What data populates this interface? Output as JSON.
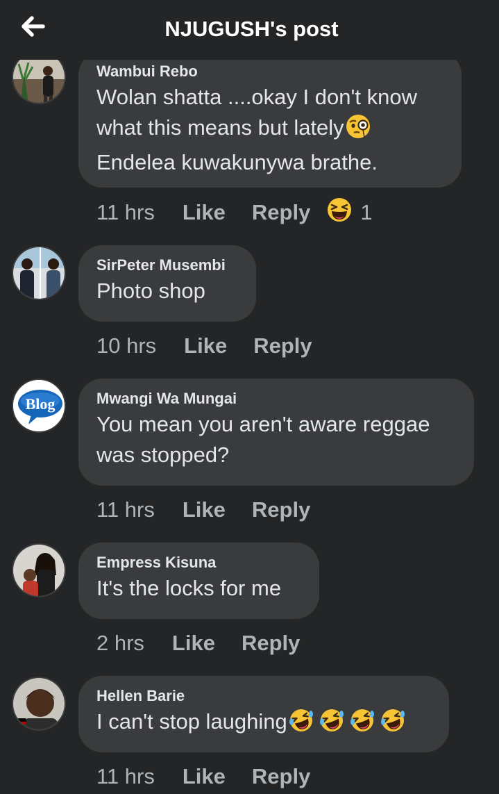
{
  "header": {
    "title": "NJUGUSH's post",
    "back_icon": "arrow-left-icon"
  },
  "colors": {
    "background": "#242526",
    "bubble": "#3a3b3c",
    "text": "#e4e6eb",
    "meta": "#b0b3b8"
  },
  "actions": {
    "like": "Like",
    "reply": "Reply"
  },
  "comments": [
    {
      "author": "Wambui Rebo",
      "lines": [
        "Wolan shatta ....okay I don't know",
        "what this means but lately",
        "Endelea kuwakunywa brathe."
      ],
      "inline_emoji": "face-with-monocle-emoji",
      "time": "11 hrs",
      "reaction": {
        "icon": "laughing-squint-emoji",
        "count": "1"
      }
    },
    {
      "author": "SirPeter Musembi",
      "lines": [
        "Photo shop"
      ],
      "time": "10 hrs"
    },
    {
      "author": "Mwangi Wa Mungai",
      "avatar_text": "Blog",
      "lines": [
        "You mean you aren't aware reggae",
        "was stopped?"
      ],
      "time": "11 hrs"
    },
    {
      "author": "Empress Kisuna",
      "lines": [
        "It's the locks for me"
      ],
      "time": "2 hrs"
    },
    {
      "author": "Hellen Barie",
      "lines": [
        "I can't stop laughing"
      ],
      "trailing_emojis": [
        "rolling-on-floor-laughing-emoji",
        "rolling-on-floor-laughing-emoji",
        "rolling-on-floor-laughing-emoji",
        "rolling-on-floor-laughing-emoji"
      ],
      "time": "11 hrs"
    }
  ]
}
